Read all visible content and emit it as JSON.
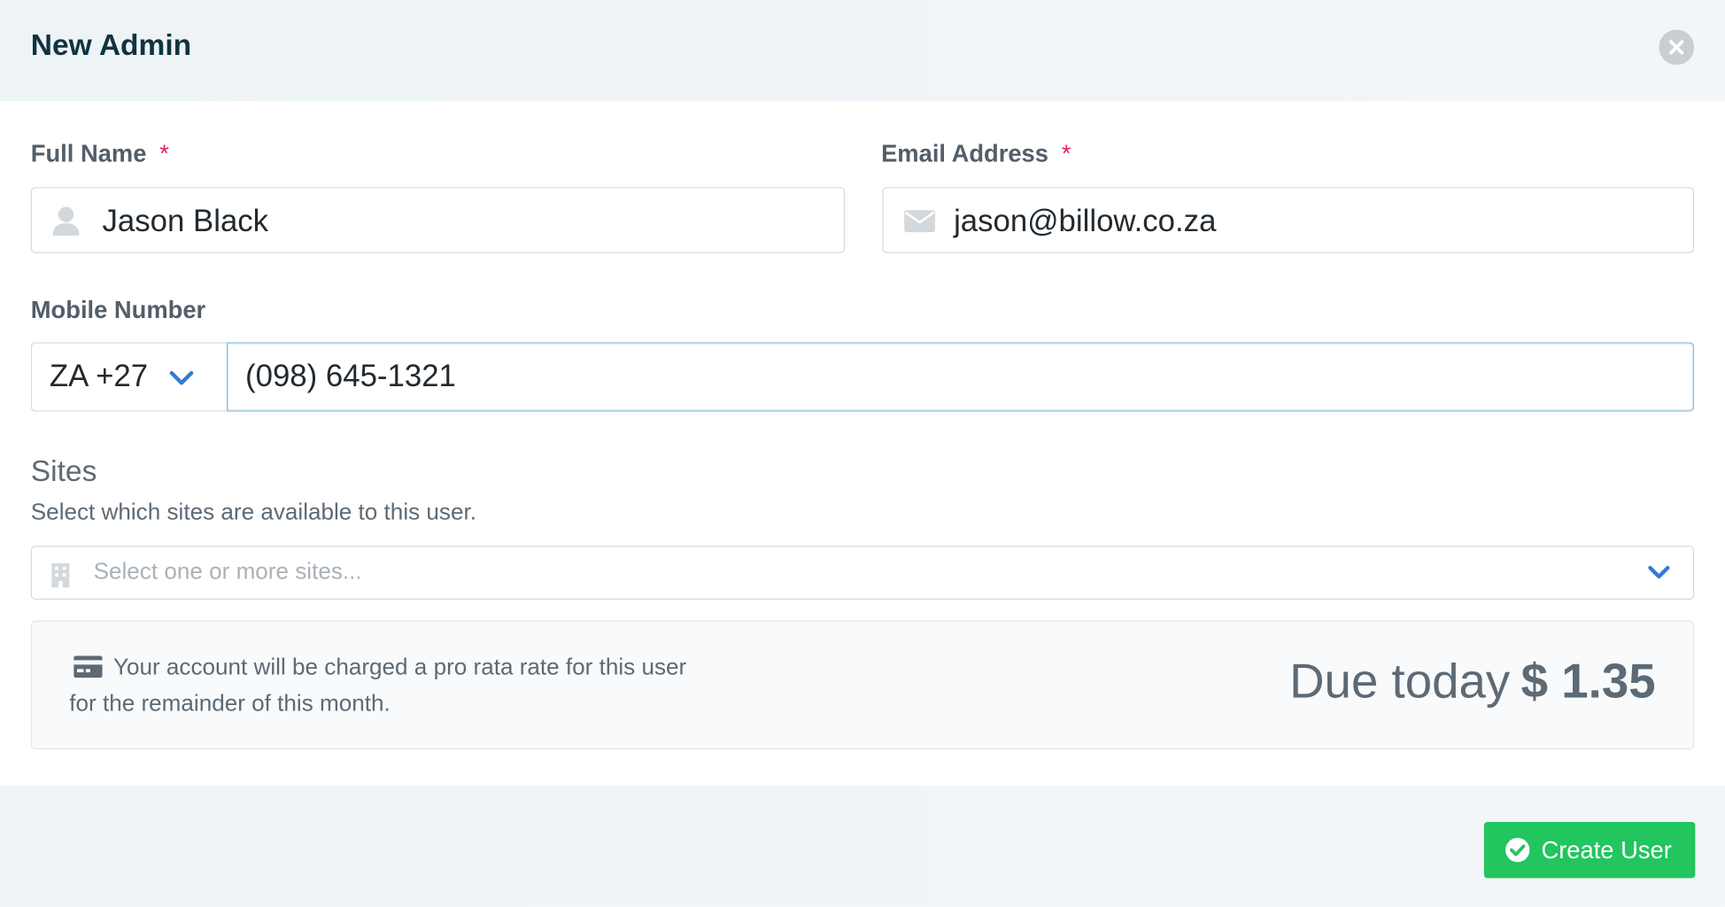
{
  "modal": {
    "title": "New Admin"
  },
  "form": {
    "full_name": {
      "label": "Full Name",
      "required_mark": "*",
      "value": "Jason Black",
      "icon": "user-icon"
    },
    "email": {
      "label": "Email Address",
      "required_mark": "*",
      "value": "jason@billow.co.za",
      "icon": "envelope-icon"
    },
    "mobile": {
      "label": "Mobile Number",
      "country": "ZA +27",
      "value": "(098) 645-1321"
    },
    "sites": {
      "title": "Sites",
      "description": "Select which sites are available to this user.",
      "placeholder": "Select one or more sites...",
      "icon": "building-icon"
    }
  },
  "billing": {
    "icon": "credit-card-icon",
    "message_line1": "Your account will be charged a pro rata rate for this user",
    "message_line2": "for the remainder of this month.",
    "due_label": "Due today",
    "due_amount": "$ 1.35"
  },
  "footer": {
    "create_button_label": "Create User"
  },
  "colors": {
    "accent_blue": "#2f7bd6",
    "required_red": "#e0245e",
    "success_green": "#22c55e",
    "title_dark": "#0f3342"
  }
}
